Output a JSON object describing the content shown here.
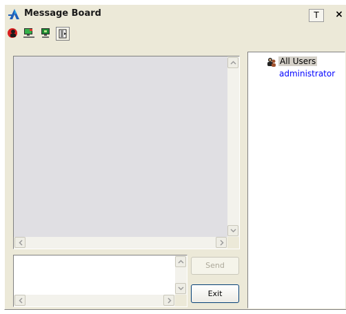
{
  "window": {
    "title": "Message Board",
    "title_buttons": {
      "pin_label": "T",
      "close_label": "×"
    }
  },
  "toolbar": {
    "items": [
      {
        "icon": "red-user-icon"
      },
      {
        "icon": "monitor-network-icon"
      },
      {
        "icon": "monitor-green-icon"
      },
      {
        "icon": "exit-door-icon",
        "pressed": true
      }
    ]
  },
  "users": {
    "group_label": "All Users",
    "items": [
      "administrator"
    ]
  },
  "compose": {
    "send_label": "Send",
    "exit_label": "Exit"
  },
  "colors": {
    "window_bg": "#ece9d8",
    "message_area_bg": "#e0dfe3",
    "user_link": "#0000ff",
    "button_border": "#003c74"
  }
}
